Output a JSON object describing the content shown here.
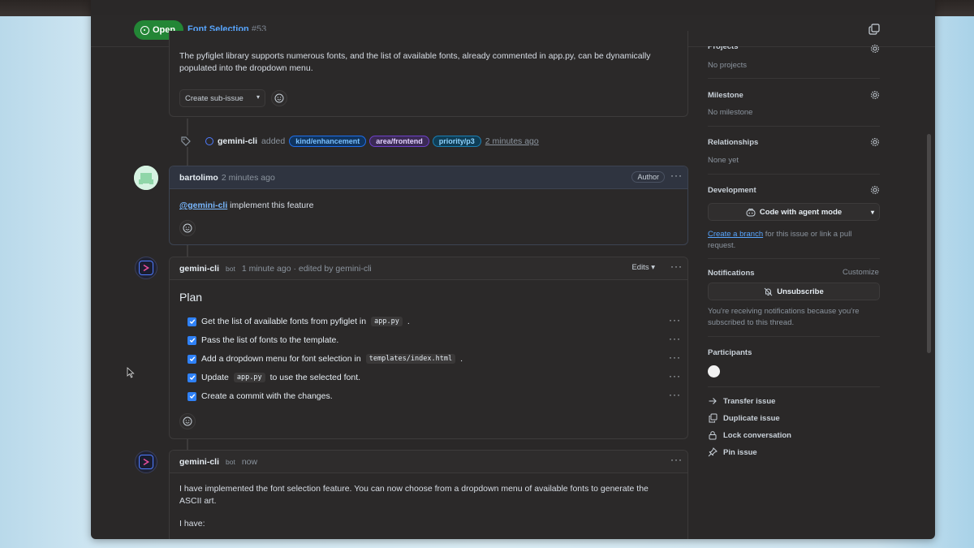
{
  "header": {
    "status": "Open",
    "title": "Font Selection",
    "number": "#53"
  },
  "first_comment": {
    "body": "The pyfiglet library supports numerous fonts, and the list of available fonts, already commented in app.py, can be dynamically populated into the dropdown menu.",
    "create_sub_issue": "Create sub-issue"
  },
  "label_event": {
    "actor": "gemini-cli",
    "action": "added",
    "labels": [
      {
        "name": "kind/enhancement",
        "bg": "#10345e",
        "border": "#1f6feb",
        "color": "#79c0ff"
      },
      {
        "name": "area/frontend",
        "bg": "#3b2a55",
        "border": "#6e40c9",
        "color": "#e2d1ff"
      },
      {
        "name": "priority/p3",
        "bg": "#0f3d55",
        "border": "#1b7fb3",
        "color": "#8fd3ff"
      }
    ],
    "time": "2 minutes ago"
  },
  "comment_bartolimo": {
    "author": "bartolimo",
    "time": "2 minutes ago",
    "badge": "Author",
    "mention": "@gemini-cli",
    "body": "implement this feature"
  },
  "comment_plan": {
    "author": "gemini-cli",
    "bot": "bot",
    "meta": "1 minute ago · edited by gemini-cli",
    "edits": "Edits",
    "heading": "Plan",
    "tasks": [
      {
        "pre": "Get the list of available fonts from pyfiglet in",
        "code": "app.py",
        "post": "."
      },
      {
        "pre": "Pass the list of fonts to the template.",
        "code": "",
        "post": ""
      },
      {
        "pre": "Add a dropdown menu for font selection in",
        "code": "templates/index.html",
        "post": "."
      },
      {
        "pre": "Update",
        "code": "app.py",
        "post": "to use the selected font."
      },
      {
        "pre": "Create a commit with the changes.",
        "code": "",
        "post": ""
      }
    ]
  },
  "comment_done": {
    "author": "gemini-cli",
    "bot": "bot",
    "time": "now",
    "body1": "I have implemented the font selection feature. You can now choose from a dropdown menu of available fonts to generate the",
    "body2": "ASCII art.",
    "body3": "I have:"
  },
  "sidebar": {
    "projects_title": "Projects",
    "projects_value": "No projects",
    "milestone_title": "Milestone",
    "milestone_value": "No milestone",
    "relationships_title": "Relationships",
    "relationships_value": "None yet",
    "development_title": "Development",
    "code_agent": "Code with agent mode",
    "create_branch": "Create a branch",
    "branch_rest1": "for this issue or link a pull",
    "branch_rest2": "request.",
    "notifications_title": "Notifications",
    "customize": "Customize",
    "unsubscribe": "Unsubscribe",
    "notif_text1": "You're receiving notifications because you're",
    "notif_text2": "subscribed to this thread.",
    "participants_title": "Participants",
    "actions": [
      "Transfer issue",
      "Duplicate issue",
      "Lock conversation",
      "Pin issue"
    ]
  }
}
